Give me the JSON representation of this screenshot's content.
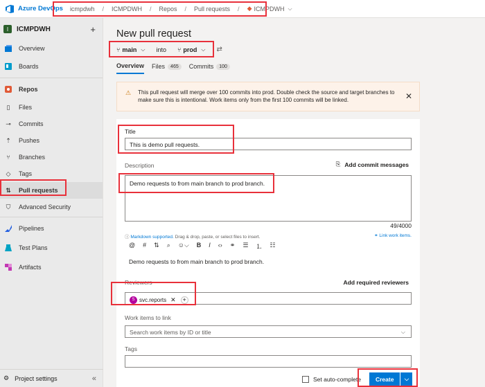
{
  "topbar": {
    "brand": "Azure DevOps",
    "breadcrumbs": [
      "icmpdwh",
      "ICMPDWH",
      "Repos",
      "Pull requests",
      "ICMPDWH"
    ]
  },
  "sidebar": {
    "project_badge": "I",
    "project_name": "ICMPDWH",
    "items": [
      {
        "label": "Overview"
      },
      {
        "label": "Boards"
      },
      {
        "label": "Repos"
      },
      {
        "label": "Files"
      },
      {
        "label": "Commits"
      },
      {
        "label": "Pushes"
      },
      {
        "label": "Branches"
      },
      {
        "label": "Tags"
      },
      {
        "label": "Pull requests"
      },
      {
        "label": "Advanced Security"
      },
      {
        "label": "Pipelines"
      },
      {
        "label": "Test Plans"
      },
      {
        "label": "Artifacts"
      }
    ],
    "settings_label": "Project settings"
  },
  "page": {
    "title": "New pull request",
    "source_branch": "main",
    "into_label": "into",
    "target_branch": "prod",
    "tabs": [
      {
        "label": "Overview",
        "count": ""
      },
      {
        "label": "Files",
        "count": "465"
      },
      {
        "label": "Commits",
        "count": "100"
      }
    ]
  },
  "warning": {
    "text": "This pull request will merge over 100 commits into prod. Double check the source and target branches to make sure this is intentional. Work items only from the first 100 commits will be linked."
  },
  "form": {
    "title_label": "Title",
    "title_value": "This is demo pull requests.",
    "description_label": "Description",
    "add_commit_messages": "Add commit messages",
    "description_value": "Demo requests to from main branch to prod branch.",
    "char_counter": "49/4000",
    "markdown_link": "Markdown supported.",
    "helper_text": "Drag & drop, paste, or select files to insert.",
    "link_work_items": "Link work items.",
    "preview_text": "Demo requests to from main branch to prod branch.",
    "reviewers_label": "Reviewers",
    "add_required_reviewers": "Add required reviewers",
    "reviewer_initial": "S",
    "reviewer_name": "svc.reports",
    "work_items_label": "Work items to link",
    "work_items_placeholder": "Search work items by ID or title",
    "tags_label": "Tags",
    "auto_complete_label": "Set auto-complete",
    "create_label": "Create"
  },
  "colors": {
    "accent": "#0078d4",
    "annotation_red": "#e8303a",
    "warning_bg": "#fdf2e9"
  }
}
